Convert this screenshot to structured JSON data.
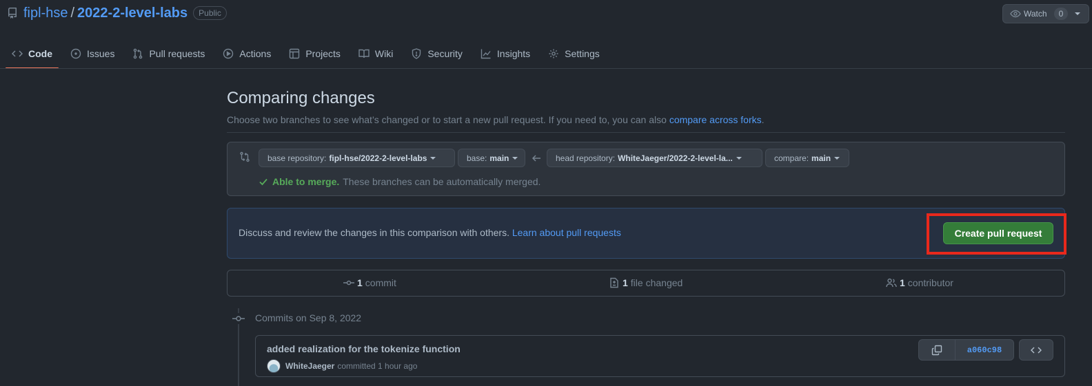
{
  "repo": {
    "owner": "fipl-hse",
    "separator": "/",
    "name": "2022-2-level-labs",
    "visibility": "Public"
  },
  "watch": {
    "label": "Watch",
    "count": "0"
  },
  "tabs": [
    {
      "label": "Code",
      "icon": "code-icon",
      "active": true
    },
    {
      "label": "Issues",
      "icon": "issue-icon"
    },
    {
      "label": "Pull requests",
      "icon": "pull-request-icon"
    },
    {
      "label": "Actions",
      "icon": "play-icon"
    },
    {
      "label": "Projects",
      "icon": "table-icon"
    },
    {
      "label": "Wiki",
      "icon": "book-icon"
    },
    {
      "label": "Security",
      "icon": "shield-icon"
    },
    {
      "label": "Insights",
      "icon": "graph-icon"
    },
    {
      "label": "Settings",
      "icon": "gear-icon"
    }
  ],
  "compare": {
    "title": "Comparing changes",
    "subtitle": "Choose two branches to see what’s changed or to start a new pull request. If you need to, you can also",
    "forks_link": "compare across forks",
    "subtitle_end": ".",
    "base_repo_label": "base repository:",
    "base_repo_value": "fipl-hse/2022-2-level-labs",
    "base_label": "base:",
    "base_value": "main",
    "head_repo_label": "head repository:",
    "head_repo_value": "WhiteJaeger/2022-2-level-la...",
    "compare_label": "compare:",
    "compare_value": "main",
    "merge_status": "Able to merge.",
    "merge_note": "These branches can be automatically merged."
  },
  "discuss": {
    "text": "Discuss and review the changes in this comparison with others.",
    "link": "Learn about pull requests",
    "button": "Create pull request"
  },
  "stats": {
    "commits_count": "1",
    "commits_label": "commit",
    "files_count": "1",
    "files_label": "file changed",
    "contributors_count": "1",
    "contributors_label": "contributor"
  },
  "commits": {
    "date_header": "Commits on Sep 8, 2022",
    "items": [
      {
        "title": "added realization for the tokenize function",
        "author": "WhiteJaeger",
        "action": "committed 1 hour ago",
        "sha": "a060c98"
      }
    ]
  },
  "colors": {
    "background": "#22272e",
    "accent_link": "#539bf5",
    "success": "#57ab5a",
    "primary_button": "#347d39",
    "highlight_box": "#e8281c",
    "active_tab_underline": "#ec775c"
  }
}
